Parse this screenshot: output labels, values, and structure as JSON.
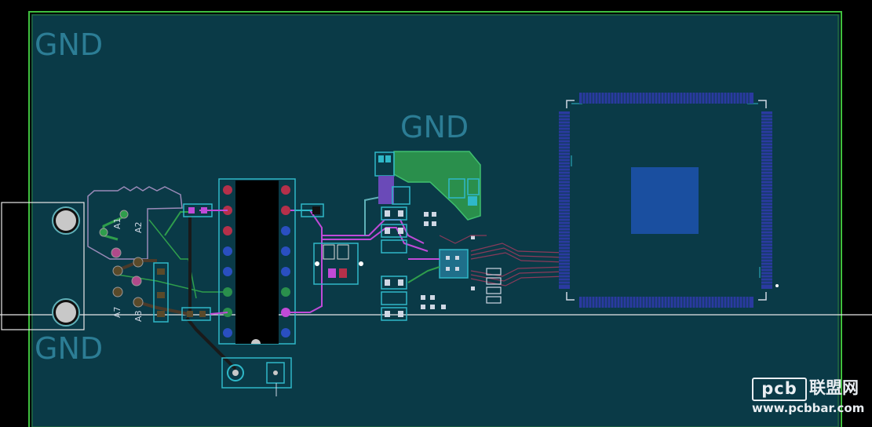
{
  "board": {
    "labels": [
      "GND",
      "GND",
      "GND"
    ],
    "silkscreen": {
      "pin_a1": "A1",
      "pin_a2": "A2",
      "pin_a7": "A7",
      "pin_a8": "A8"
    }
  },
  "watermark": {
    "logo": "pcb",
    "name": "联盟网",
    "url": "www.pcbbar.com"
  },
  "colors": {
    "background": "#000000",
    "copper_pour": "#0a3a47",
    "board_outline": "#3fbf3f",
    "pad_outline": "#2fb8c8",
    "trace_green": "#2f9e4c",
    "trace_magenta": "#c04ad8",
    "trace_teal": "#5fb0b8",
    "component_body": "#000000",
    "cpu_pad": "#1a4fa0",
    "pin_red": "#b5304a",
    "pin_blue": "#2a4fc0"
  }
}
